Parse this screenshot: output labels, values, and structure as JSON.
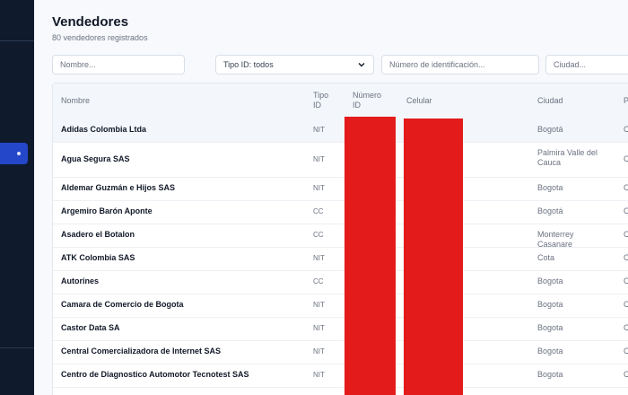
{
  "page": {
    "title": "Vendedores",
    "subtitle": "80 vendedores registrados"
  },
  "filters": {
    "nombre_placeholder": "Nombre...",
    "tipo_id_value": "Tipo ID: todos",
    "numero_placeholder": "Número de identificación...",
    "ciudad_placeholder": "Ciudad..."
  },
  "table": {
    "headers": {
      "nombre": "Nombre",
      "tipo_id": "Tipo ID",
      "numero_id": "Número ID",
      "celular": "Celular",
      "ciudad": "Ciudad",
      "p": "P"
    },
    "rows": [
      {
        "nombre": "Adidas Colombia Ltda",
        "tipo": "NIT",
        "ciudad": "Bogotá",
        "p": "C"
      },
      {
        "nombre": "Agua Segura SAS",
        "tipo": "NIT",
        "ciudad": "Palmira Valle del Cauca",
        "p": "C"
      },
      {
        "nombre": "Aldemar Guzmán e Hijos SAS",
        "tipo": "NIT",
        "ciudad": "Bogota",
        "p": "C"
      },
      {
        "nombre": "Argemiro Barón Aponte",
        "tipo": "CC",
        "ciudad": "Bogotá",
        "p": "C"
      },
      {
        "nombre": "Asadero el Botalon",
        "tipo": "CC",
        "ciudad": "Monterrey Casanare",
        "p": "C"
      },
      {
        "nombre": "ATK Colombia SAS",
        "tipo": "NIT",
        "ciudad": "Cota",
        "p": "C"
      },
      {
        "nombre": "Autorines",
        "tipo": "CC",
        "ciudad": "Bogota",
        "p": "C"
      },
      {
        "nombre": "Camara de Comercio de Bogota",
        "tipo": "NIT",
        "ciudad": "Bogota",
        "p": "C"
      },
      {
        "nombre": "Castor Data SA",
        "tipo": "NIT",
        "ciudad": "Bogota",
        "p": "C"
      },
      {
        "nombre": "Central Comercializadora de Internet SAS",
        "tipo": "NIT",
        "ciudad": "Bogota",
        "p": "C"
      },
      {
        "nombre": "Centro de Diagnostico Automotor Tecnotest SAS",
        "tipo": "NIT",
        "ciudad": "Bogota",
        "p": "C"
      }
    ]
  },
  "colors": {
    "sidebar": "#0f1b2d",
    "accent": "#2447c9",
    "redaction": "#e31b1b"
  }
}
